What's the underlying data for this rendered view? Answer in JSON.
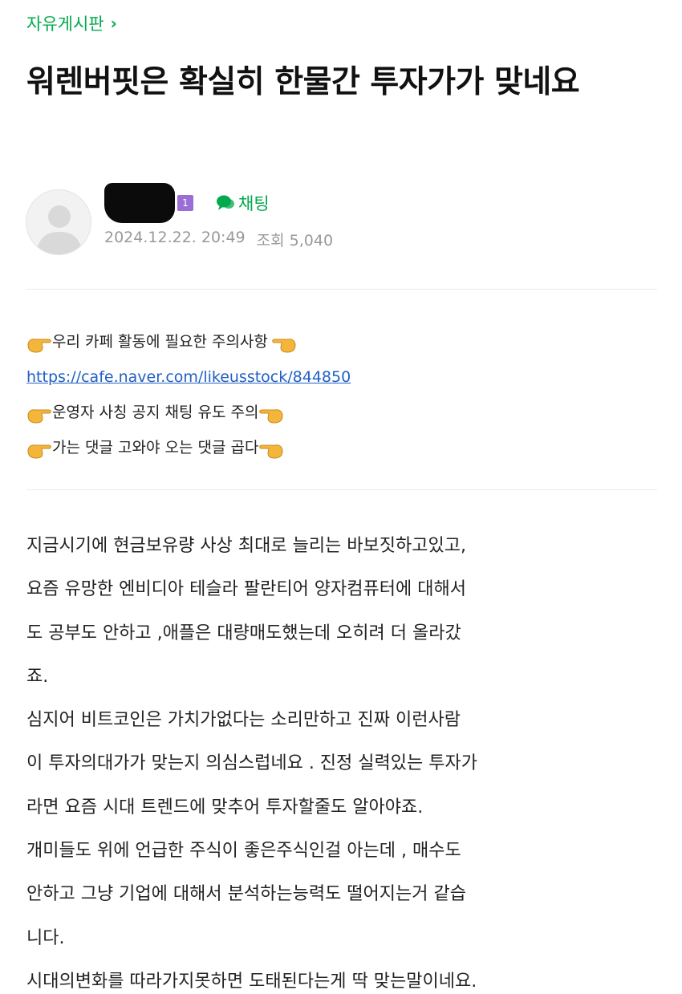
{
  "board": {
    "name": "자유게시판",
    "chevron": "›"
  },
  "post": {
    "title": "워렌버핏은 확실히 한물간 투자가가 맞네요",
    "author": {
      "name": "■■■■",
      "level": "1",
      "avatar_icon": "default-avatar-icon"
    },
    "chat_label": "채팅",
    "date": "2024.12.22. 20:49",
    "views_label": "조회",
    "views": "5,040"
  },
  "notice": {
    "line1": "우리 카페 활동에 필요한 주의사항",
    "link": "https://cafe.naver.com/likeusstock/844850",
    "line3": "운영자 사칭 공지 채팅 유도 주의",
    "line4": "가는 댓글 고와야 오는 댓글 곱다"
  },
  "body": [
    "지금시기에 현금보유량 사상 최대로 늘리는 바보짓하고있고,",
    "요즘 유망한 엔비디아 테슬라 팔란티어 양자컴퓨터에 대해서",
    "도 공부도 안하고 ,애플은 대량매도했는데 오히려 더 올라갔",
    "죠.",
    "심지어 비트코인은 가치가없다는 소리만하고 진짜 이런사람",
    "이 투자의대가가 맞는지 의심스럽네요 . 진정 실력있는 투자가",
    "라면 요즘 시대 트렌드에 맞추어 투자할줄도 알아야죠.",
    "개미들도 위에 언급한 주식이 좋은주식인걸 아는데 , 매수도",
    "안하고 그냥 기업에 대해서 분석하는능력도 떨어지는거 같습",
    "니다.",
    "시대의변화를 따라가지못하면 도태된다는게 딱 맞는말이네요."
  ],
  "colors": {
    "accent_green": "#03a94d",
    "link_blue": "#2160c4",
    "meta_gray": "#999999",
    "level_purple": "#9b6ed6"
  }
}
